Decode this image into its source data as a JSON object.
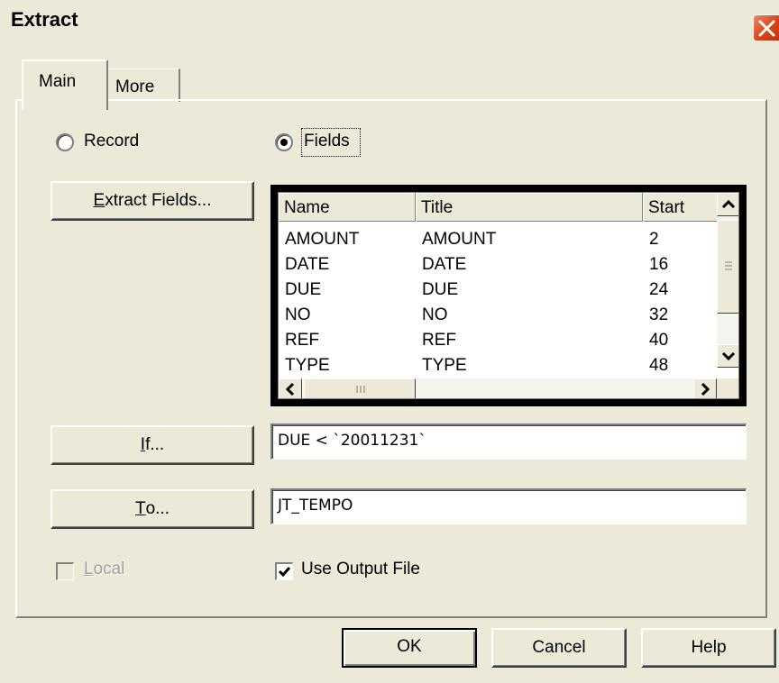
{
  "window": {
    "title": "Extract"
  },
  "tabs": [
    {
      "label": "Main",
      "selected": true
    },
    {
      "label": "More",
      "selected": false
    }
  ],
  "record_option": {
    "label": "Record",
    "selected": false
  },
  "fields_option": {
    "label": "Fields",
    "selected": true
  },
  "extract_fields_button": {
    "label_prefix": "",
    "mnemonic": "E",
    "label_rest": "xtract Fields..."
  },
  "fields_list": {
    "columns": [
      "Name",
      "Title",
      "Start"
    ],
    "rows": [
      [
        "AMOUNT",
        "AMOUNT",
        "2"
      ],
      [
        "DATE",
        "DATE",
        "16"
      ],
      [
        "DUE",
        "DUE",
        "24"
      ],
      [
        "NO",
        "NO",
        "32"
      ],
      [
        "REF",
        "REF",
        "40"
      ],
      [
        "TYPE",
        "TYPE",
        "48"
      ]
    ]
  },
  "if_button": {
    "mnemonic": "I",
    "label_rest": "f..."
  },
  "if_field": {
    "value": "DUE < `20011231`"
  },
  "to_button": {
    "mnemonic": "T",
    "label_rest": "o..."
  },
  "to_field": {
    "value": "JT_TEMPO"
  },
  "local_checkbox": {
    "mnemonic": "L",
    "label_rest": "ocal",
    "checked": false,
    "enabled": false
  },
  "use_output_file": {
    "label": "Use Output File",
    "checked": true
  },
  "buttons": {
    "ok": "OK",
    "cancel": "Cancel",
    "help": "Help"
  }
}
